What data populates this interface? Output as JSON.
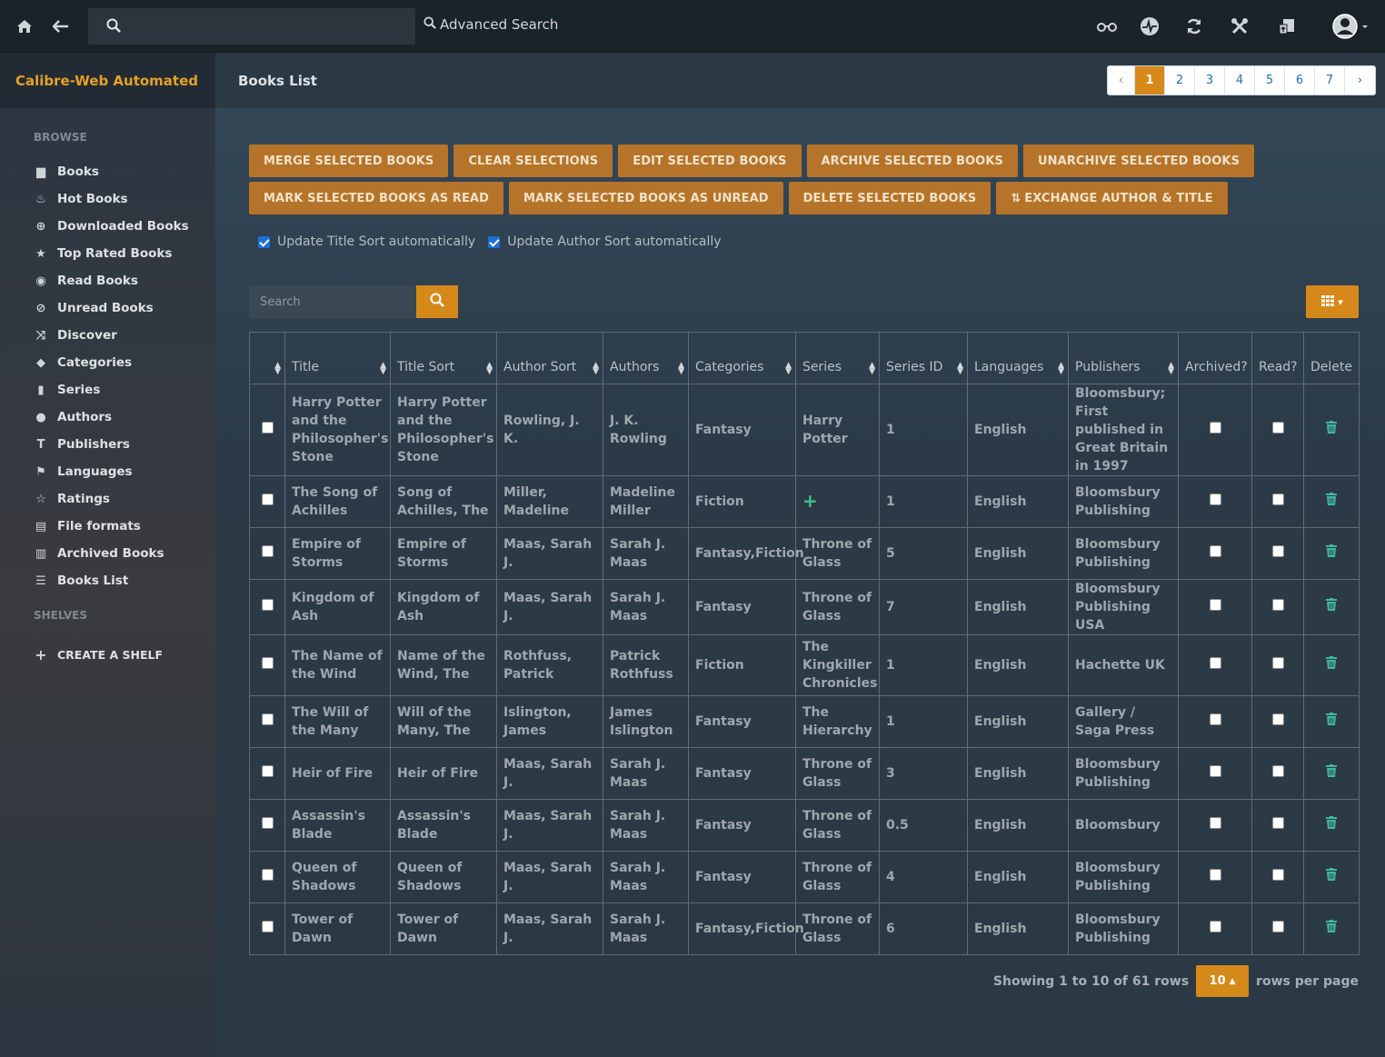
{
  "topbar": {
    "search_placeholder": "",
    "advanced_search": "Advanced Search",
    "icons": [
      "home-icon",
      "back-icon",
      "search-icon",
      "glasses-icon",
      "heartbeat-icon",
      "refresh-icon",
      "tools-icon",
      "upload-icon",
      "user-icon"
    ]
  },
  "sidebar": {
    "brand": "Calibre-Web Automated",
    "browse_header": "BROWSE",
    "items": [
      {
        "label": "Books",
        "icon": "book-icon"
      },
      {
        "label": "Hot Books",
        "icon": "fire-icon"
      },
      {
        "label": "Downloaded Books",
        "icon": "download-icon"
      },
      {
        "label": "Top Rated Books",
        "icon": "star-icon"
      },
      {
        "label": "Read Books",
        "icon": "eye-icon"
      },
      {
        "label": "Unread Books",
        "icon": "eye-slash-icon"
      },
      {
        "label": "Discover",
        "icon": "shuffle-icon"
      },
      {
        "label": "Categories",
        "icon": "tags-icon"
      },
      {
        "label": "Series",
        "icon": "bookmark-icon"
      },
      {
        "label": "Authors",
        "icon": "user-icon"
      },
      {
        "label": "Publishers",
        "icon": "text-icon"
      },
      {
        "label": "Languages",
        "icon": "flag-icon"
      },
      {
        "label": "Ratings",
        "icon": "star-outline-icon"
      },
      {
        "label": "File formats",
        "icon": "file-icon"
      },
      {
        "label": "Archived Books",
        "icon": "trash-icon"
      },
      {
        "label": "Books List",
        "icon": "list-icon"
      }
    ],
    "shelves_header": "SHELVES",
    "create_shelf": "CREATE A SHELF"
  },
  "main": {
    "title": "Books List",
    "pagination": [
      "‹",
      "1",
      "2",
      "3",
      "4",
      "5",
      "6",
      "7",
      "›"
    ],
    "active_page": "1",
    "buttons_row1": [
      "MERGE SELECTED BOOKS",
      "CLEAR SELECTIONS",
      "EDIT SELECTED BOOKS",
      "ARCHIVE SELECTED BOOKS",
      "UNARCHIVE SELECTED BOOKS"
    ],
    "buttons_row2": [
      "MARK SELECTED BOOKS AS READ",
      "MARK SELECTED BOOKS AS UNREAD",
      "DELETE SELECTED BOOKS",
      "EXCHANGE AUTHOR & TITLE"
    ],
    "check_title_sort": "Update Title Sort automatically",
    "check_author_sort": "Update Author Sort automatically",
    "search_placeholder": "Search",
    "columns": [
      "Title",
      "Title Sort",
      "Author Sort",
      "Authors",
      "Categories",
      "Series",
      "Series ID",
      "Languages",
      "Publishers",
      "Archived?",
      "Read?",
      "Delete"
    ],
    "rows": [
      [
        "Harry Potter and the Philosopher's Stone",
        "Harry Potter and the Philosopher's Stone",
        "Rowling, J. K.",
        "J. K. Rowling",
        "Fantasy",
        "Harry Potter",
        "1",
        "English",
        "Bloomsbury; First published in Great Britain in 1997"
      ],
      [
        "The Song of Achilles",
        "Song of Achilles, The",
        "Miller, Madeline",
        "Madeline Miller",
        "Fiction",
        "+",
        "1",
        "English",
        "Bloomsbury Publishing"
      ],
      [
        "Empire of Storms",
        "Empire of Storms",
        "Maas, Sarah J.",
        "Sarah J. Maas",
        "Fantasy,Fiction",
        "Throne of Glass",
        "5",
        "English",
        "Bloomsbury Publishing"
      ],
      [
        "Kingdom of Ash",
        "Kingdom of Ash",
        "Maas, Sarah J.",
        "Sarah J. Maas",
        "Fantasy",
        "Throne of Glass",
        "7",
        "English",
        "Bloomsbury Publishing USA"
      ],
      [
        "The Name of the Wind",
        "Name of the Wind, The",
        "Rothfuss, Patrick",
        "Patrick Rothfuss",
        "Fiction",
        "The Kingkiller Chronicles",
        "1",
        "English",
        "Hachette UK"
      ],
      [
        "The Will of the Many",
        "Will of the Many, The",
        "Islington, James",
        "James Islington",
        "Fantasy",
        "The Hierarchy",
        "1",
        "English",
        "Gallery / Saga Press"
      ],
      [
        "Heir of Fire",
        "Heir of Fire",
        "Maas, Sarah J.",
        "Sarah J. Maas",
        "Fantasy",
        "Throne of Glass",
        "3",
        "English",
        "Bloomsbury Publishing"
      ],
      [
        "Assassin's Blade",
        "Assassin's Blade",
        "Maas, Sarah J.",
        "Sarah J. Maas",
        "Fantasy",
        "Throne of Glass",
        "0.5",
        "English",
        "Bloomsbury"
      ],
      [
        "Queen of Shadows",
        "Queen of Shadows",
        "Maas, Sarah J.",
        "Sarah J. Maas",
        "Fantasy",
        "Throne of Glass",
        "4",
        "English",
        "Bloomsbury Publishing"
      ],
      [
        "Tower of Dawn",
        "Tower of Dawn",
        "Maas, Sarah J.",
        "Sarah J. Maas",
        "Fantasy,Fiction",
        "Throne of Glass",
        "6",
        "English",
        "Bloomsbury Publishing"
      ]
    ],
    "footer_showing": "Showing 1 to 10 of 61 rows",
    "rows_per_page": "10",
    "rows_per_page_label": "rows per page",
    "colors": {
      "accent": "#d6891b",
      "button": "#b5742a",
      "brand": "#e5a128",
      "trash": "#3fb6a0"
    }
  }
}
